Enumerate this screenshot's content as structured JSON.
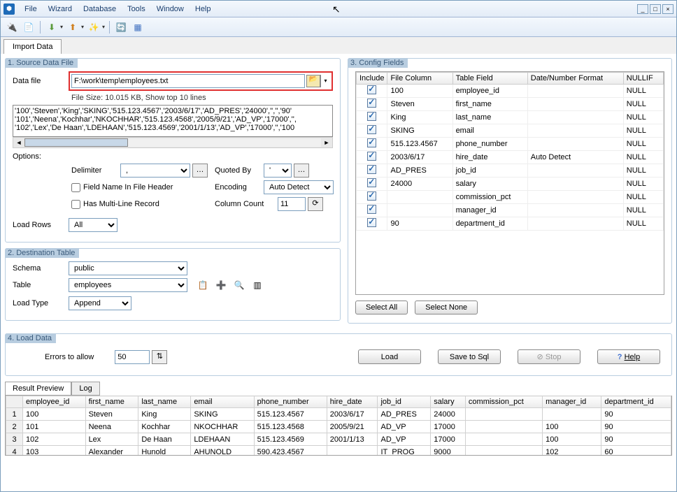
{
  "menubar": {
    "items": [
      "File",
      "Wizard",
      "Database",
      "Tools",
      "Window",
      "Help"
    ]
  },
  "tab": {
    "name": "Import Data"
  },
  "source": {
    "legend": "1. Source Data File",
    "file_label": "Data file",
    "file_value": "F:\\work\\temp\\employees.txt",
    "file_hint": "File Size: 10.015 KB,  Show top 10 lines",
    "preview_lines": [
      "'100','Steven','King','SKING','515.123.4567','2003/6/17','AD_PRES','24000','','','90'",
      "'101','Neena','Kochhar','NKOCHHAR','515.123.4568','2005/9/21','AD_VP','17000','',",
      "'102','Lex','De Haan','LDEHAAN','515.123.4569','2001/1/13','AD_VP','17000','','100"
    ],
    "options_label": "Options:",
    "delimiter_label": "Delimiter",
    "delimiter_value": ",",
    "quoted_label": "Quoted By",
    "quoted_value": "'",
    "field_header_label": "Field Name In File Header",
    "encoding_label": "Encoding",
    "encoding_value": "Auto Detect",
    "multiline_label": "Has Multi-Line Record",
    "colcount_label": "Column Count",
    "colcount_value": "11",
    "loadrows_label": "Load Rows",
    "loadrows_value": "All"
  },
  "dest": {
    "legend": "2. Destination Table",
    "schema_label": "Schema",
    "schema_value": "public",
    "table_label": "Table",
    "table_value": "employees",
    "loadtype_label": "Load Type",
    "loadtype_value": "Append"
  },
  "config": {
    "legend": "3. Config Fields",
    "headers": [
      "Include",
      "File Column",
      "Table Field",
      "Date/Number Format",
      "NULLIF"
    ],
    "rows": [
      {
        "include": true,
        "file_col": "100",
        "table_field": "employee_id",
        "fmt": "",
        "nullif": "NULL"
      },
      {
        "include": true,
        "file_col": "Steven",
        "table_field": "first_name",
        "fmt": "",
        "nullif": "NULL"
      },
      {
        "include": true,
        "file_col": "King",
        "table_field": "last_name",
        "fmt": "",
        "nullif": "NULL"
      },
      {
        "include": true,
        "file_col": "SKING",
        "table_field": "email",
        "fmt": "",
        "nullif": "NULL"
      },
      {
        "include": true,
        "file_col": "515.123.4567",
        "table_field": "phone_number",
        "fmt": "",
        "nullif": "NULL"
      },
      {
        "include": true,
        "file_col": "2003/6/17",
        "table_field": "hire_date",
        "fmt": "Auto Detect",
        "nullif": "NULL"
      },
      {
        "include": true,
        "file_col": "AD_PRES",
        "table_field": "job_id",
        "fmt": "",
        "nullif": "NULL"
      },
      {
        "include": true,
        "file_col": "24000",
        "table_field": "salary",
        "fmt": "",
        "nullif": "NULL"
      },
      {
        "include": true,
        "file_col": "",
        "table_field": "commission_pct",
        "fmt": "",
        "nullif": "NULL"
      },
      {
        "include": true,
        "file_col": "",
        "table_field": "manager_id",
        "fmt": "",
        "nullif": "NULL"
      },
      {
        "include": true,
        "file_col": "90",
        "table_field": "department_id",
        "fmt": "",
        "nullif": "NULL"
      }
    ],
    "select_all": "Select All",
    "select_none": "Select None"
  },
  "load": {
    "legend": "4. Load Data",
    "errors_label": "Errors to allow",
    "errors_value": "50",
    "load_btn": "Load",
    "save_btn": "Save to Sql",
    "stop_btn": "Stop",
    "help_btn": "Help"
  },
  "result": {
    "tab1": "Result Preview",
    "tab2": "Log",
    "headers": [
      "employee_id",
      "first_name",
      "last_name",
      "email",
      "phone_number",
      "hire_date",
      "job_id",
      "salary",
      "commission_pct",
      "manager_id",
      "department_id"
    ],
    "rows": [
      {
        "n": "1",
        "c": [
          "100",
          "Steven",
          "King",
          "SKING",
          "515.123.4567",
          "2003/6/17",
          "AD_PRES",
          "24000",
          "",
          "",
          "90"
        ]
      },
      {
        "n": "2",
        "c": [
          "101",
          "Neena",
          "Kochhar",
          "NKOCHHAR",
          "515.123.4568",
          "2005/9/21",
          "AD_VP",
          "17000",
          "",
          "100",
          "90"
        ]
      },
      {
        "n": "3",
        "c": [
          "102",
          "Lex",
          "De Haan",
          "LDEHAAN",
          "515.123.4569",
          "2001/1/13",
          "AD_VP",
          "17000",
          "",
          "100",
          "90"
        ]
      },
      {
        "n": "4",
        "c": [
          "103",
          "Alexander",
          "Hunold",
          "AHUNOLD",
          "590.423.4567",
          "",
          "IT_PROG",
          "9000",
          "",
          "102",
          "60"
        ]
      }
    ]
  }
}
